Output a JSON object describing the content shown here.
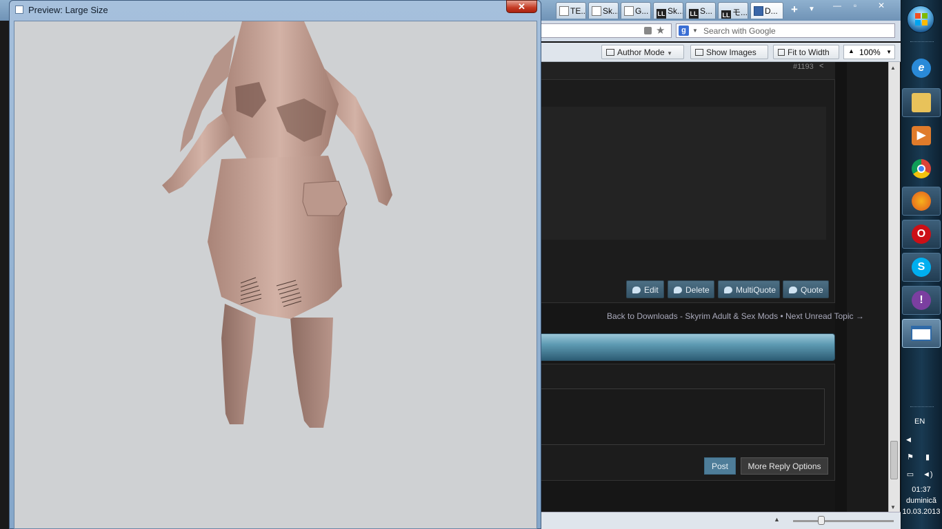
{
  "browser": {
    "tabs": [
      {
        "label": "TE...",
        "icon": "page-icon"
      },
      {
        "label": "Sk...",
        "icon": "page-icon"
      },
      {
        "label": "G...",
        "icon": "page-icon"
      },
      {
        "label": "Sk...",
        "icon": "ll-icon"
      },
      {
        "label": "S...",
        "icon": "ll-icon"
      },
      {
        "label": "モ...",
        "icon": "ll-icon"
      },
      {
        "label": "D...",
        "icon": "download-icon"
      }
    ],
    "new_tab": "+",
    "tab_list": "▼",
    "window_controls": {
      "minimize": "—",
      "maximize": "▫",
      "close": "✕"
    },
    "search_placeholder": "Search with Google",
    "search_engine_letter": "g",
    "toolbar": {
      "author_mode": "Author Mode",
      "show_images": "Show Images",
      "fit_to_width": "Fit to Width",
      "zoom": "100%"
    }
  },
  "page": {
    "post_number": "#1193",
    "actions": [
      "Edit",
      "Delete",
      "MultiQuote",
      "Quote"
    ],
    "back_link": "Back to Downloads - Skyrim Adult & Sex Mods",
    "next_link": "Next Unread Topic",
    "separator": " • ",
    "post_button": "Post",
    "more_options_button": "More Reply Options"
  },
  "preview_window": {
    "title": "Preview: Large Size",
    "close": "✕",
    "background_color": "#cfd1d3",
    "model_color": "#c9a89c"
  },
  "taskbar": {
    "apps": [
      "internet-explorer-icon",
      "file-explorer-icon",
      "media-player-icon",
      "chrome-icon",
      "firefox-icon",
      "opera-icon",
      "skype-icon",
      "yahoo-messenger-icon",
      "window-icon"
    ],
    "language": "EN",
    "time": "01:37",
    "day": "duminică",
    "date": "10.03.2013"
  },
  "colors": {
    "action_button": "#4d6f84",
    "post_button": "#4e7d99",
    "banner": "#5d9ab2"
  }
}
